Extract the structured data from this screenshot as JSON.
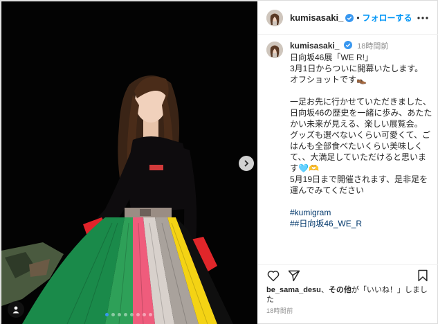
{
  "post": {
    "username": "kumisasaki_",
    "follow_label": "フォローする",
    "separator": "•",
    "caption": {
      "time": "18時間前",
      "lines": [
        "日向坂46展「WE R!」",
        "3月1日からついに開幕いたします。",
        "オフショットです👞",
        "",
        "一足お先に行かせていただきました、日向坂46の歴史を一緒に歩み、あたたかい未来が見える、楽しい展覧会。",
        "グッズも選べないくらい可愛くて、ごはんも全部食べたいくらい美味しくて、、大満足していただけると思います🩵🫶",
        "5月19日まで開催されます、是非足を運んでみてください",
        ""
      ],
      "hashtags": [
        "#kumigram",
        "##日向坂46_WE_R"
      ]
    },
    "likes": {
      "user": "be_sama_desu",
      "connector": "、",
      "others_label": "その他",
      "suffix": "が「いいね！」しました"
    },
    "posted_time": "18時間前",
    "carousel": {
      "count": 8,
      "active_index": 0
    }
  },
  "icons": {
    "header_more": "more-horizontal-icon",
    "verified": "verified-badge-icon",
    "like": "heart-outline-icon",
    "share": "paper-plane-icon",
    "save": "bookmark-icon",
    "next": "chevron-right-icon",
    "tags": "user-tag-icon"
  },
  "colors": {
    "follow": "#0095f6",
    "hashtag": "#00376b",
    "verified": "#3897f0",
    "secondary_text": "#8e8e8e"
  }
}
